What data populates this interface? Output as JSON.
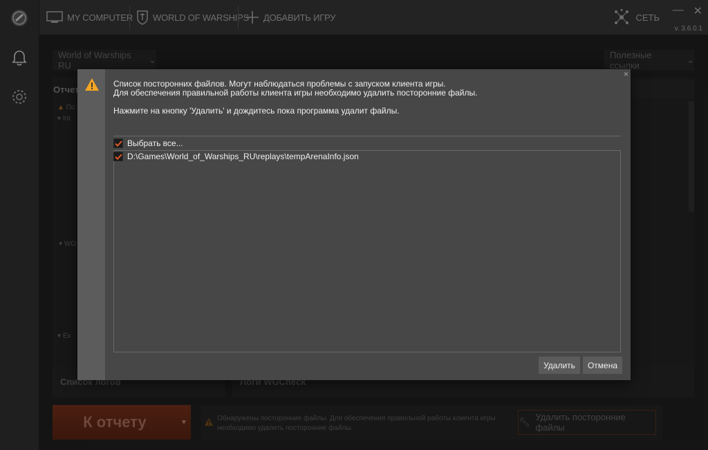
{
  "topbar": {
    "tabs": [
      {
        "label": "MY COMPUTER",
        "icon": "monitor-icon"
      },
      {
        "label": "WORLD OF WARSHIPS",
        "icon": "warships-emblem-icon"
      },
      {
        "label": "ДОБАВИТЬ ИГРУ",
        "icon": "plus-icon"
      }
    ],
    "network_label": "СЕТЬ",
    "version": "v. 3.6.0.1"
  },
  "rail": {
    "icons": [
      "app-logo-icon",
      "bell-icon",
      "gear-icon"
    ]
  },
  "main": {
    "game_select": "World of Warships RU",
    "links_select": "Полезные ссылки",
    "report_title": "Отчет",
    "tree": [
      "По",
      "Int",
      "WO",
      "Ex"
    ],
    "logs_list_title": "Список логов",
    "logs_title": "Логи WGCheck"
  },
  "bottom": {
    "report_button": "К отчету",
    "notice": "Обнаружены посторонние файлы. Для обеспечения правильной работы клиента игры необходимо удалить посторонние файлы.",
    "remove_button": "Удалить посторонние файлы"
  },
  "dialog": {
    "line1": "Список посторонних файлов. Могут наблюдаться проблемы с запуском клиента игры.",
    "line2": "Для обеспечения правильной работы клиента игры необходимо удалить посторонние файлы.",
    "line3": "Нажмите на кнопку 'Удалить' и дождитесь пока программа удалит файлы.",
    "select_all": "Выбрать все...",
    "files": [
      "D:\\Games\\World_of_Warships_RU\\replays\\tempArenaInfo.json"
    ],
    "delete_label": "Удалить",
    "cancel_label": "Отмена",
    "close_glyph": "×"
  },
  "colors": {
    "accent": "#e05a2b",
    "warn": "#f5a623"
  }
}
